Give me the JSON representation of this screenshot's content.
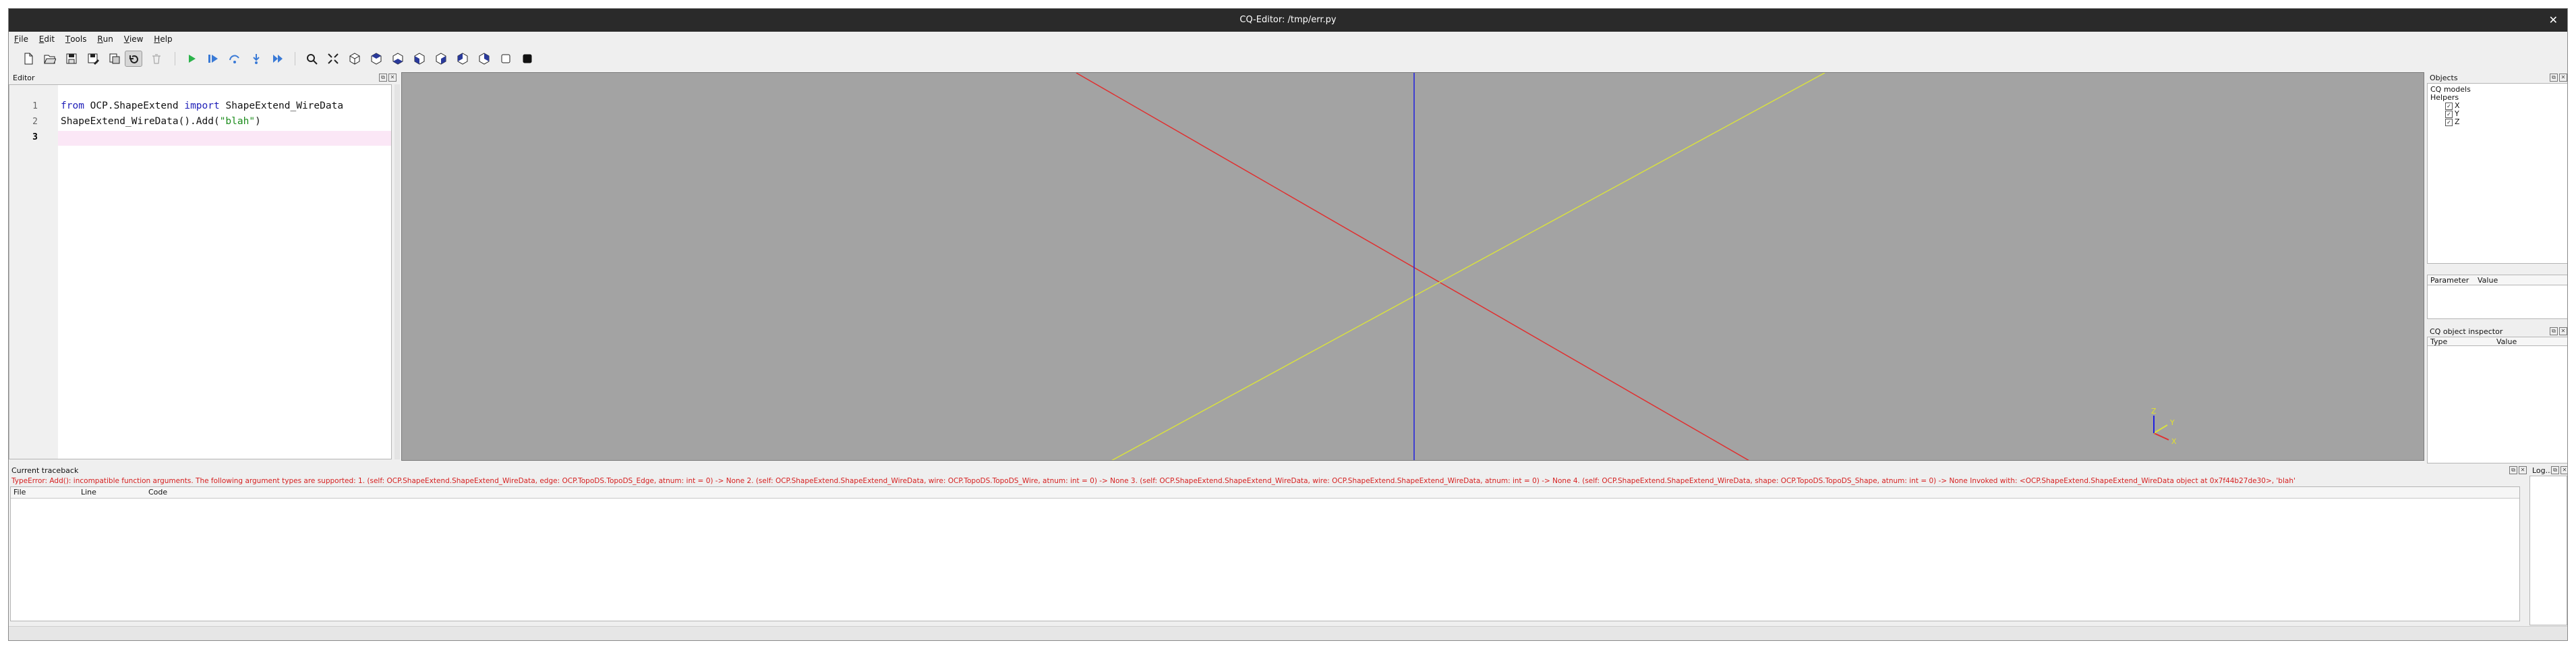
{
  "window": {
    "title": "CQ-Editor: /tmp/err.py",
    "close_glyph": "✕"
  },
  "menu": {
    "file": {
      "accel": "F",
      "rest": "ile"
    },
    "edit": {
      "accel": "E",
      "rest": "dit"
    },
    "tools": {
      "accel": "T",
      "rest": "ools"
    },
    "run": {
      "accel": "R",
      "rest": "un"
    },
    "view": {
      "accel": "V",
      "rest": "iew"
    },
    "help": {
      "accel": "H",
      "rest": "elp"
    }
  },
  "toolbar": {
    "icons": [
      "new-file-icon",
      "open-file-icon",
      "save-icon",
      "save-as-icon",
      "autoreload-icon",
      "clear-icon",
      "delete-icon",
      "run-icon",
      "debug-icon",
      "step-icon",
      "step-in-icon",
      "continue-icon",
      "zoom-icon",
      "fit-icon",
      "iso-view-icon",
      "top-view-icon",
      "bottom-view-icon",
      "front-view-icon",
      "back-view-icon",
      "left-view-icon",
      "right-view-icon",
      "wireframe-icon",
      "shaded-icon"
    ]
  },
  "editor": {
    "title": "Editor",
    "line_numbers": [
      "1",
      "2",
      "3"
    ],
    "line1": {
      "kw1": "from",
      "mod": "OCP.ShapeExtend",
      "kw2": "import",
      "name": "ShapeExtend_WireData"
    },
    "line2": {
      "call": "ShapeExtend_WireData().Add(",
      "arg": "\"blah\"",
      "close": ")"
    }
  },
  "viewer": {
    "axis_colors": {
      "x": "#e03030",
      "y": "#d8e040",
      "z": "#2020e0"
    },
    "triad_labels": {
      "x": "X",
      "y": "Y",
      "z": "Z"
    }
  },
  "objects": {
    "title": "Objects",
    "cq_models": "CQ models",
    "helpers": "Helpers",
    "items": [
      "X",
      "Y",
      "Z"
    ],
    "check_glyph": "✓"
  },
  "parameters": {
    "col_param": "Parameter",
    "col_value": "Value"
  },
  "inspector": {
    "title": "CQ object inspector",
    "col_type": "Type",
    "col_value": "Value"
  },
  "traceback": {
    "title": "Current traceback",
    "error": "TypeError: Add(): incompatible function arguments. The following argument types are supported: 1. (self: OCP.ShapeExtend.ShapeExtend_WireData, edge: OCP.TopoDS.TopoDS_Edge, atnum: int = 0) -> None 2. (self: OCP.ShapeExtend.ShapeExtend_WireData, wire: OCP.TopoDS.TopoDS_Wire, atnum: int = 0) -> None 3. (self: OCP.ShapeExtend.ShapeExtend_WireData, wire: OCP.ShapeExtend.ShapeExtend_WireData, atnum: int = 0) -> None 4. (self: OCP.ShapeExtend.ShapeExtend_WireData, shape: OCP.TopoDS.TopoDS_Shape, atnum: int = 0) -> None Invoked with: <OCP.ShapeExtend.ShapeExtend_WireData object at 0x7f44b27de30>, 'blah'",
    "col_file": "File",
    "col_line": "Line",
    "col_code": "Code"
  },
  "log": {
    "title": "Log..."
  },
  "dock_buttons": {
    "float": "⧉",
    "close": "✕"
  }
}
